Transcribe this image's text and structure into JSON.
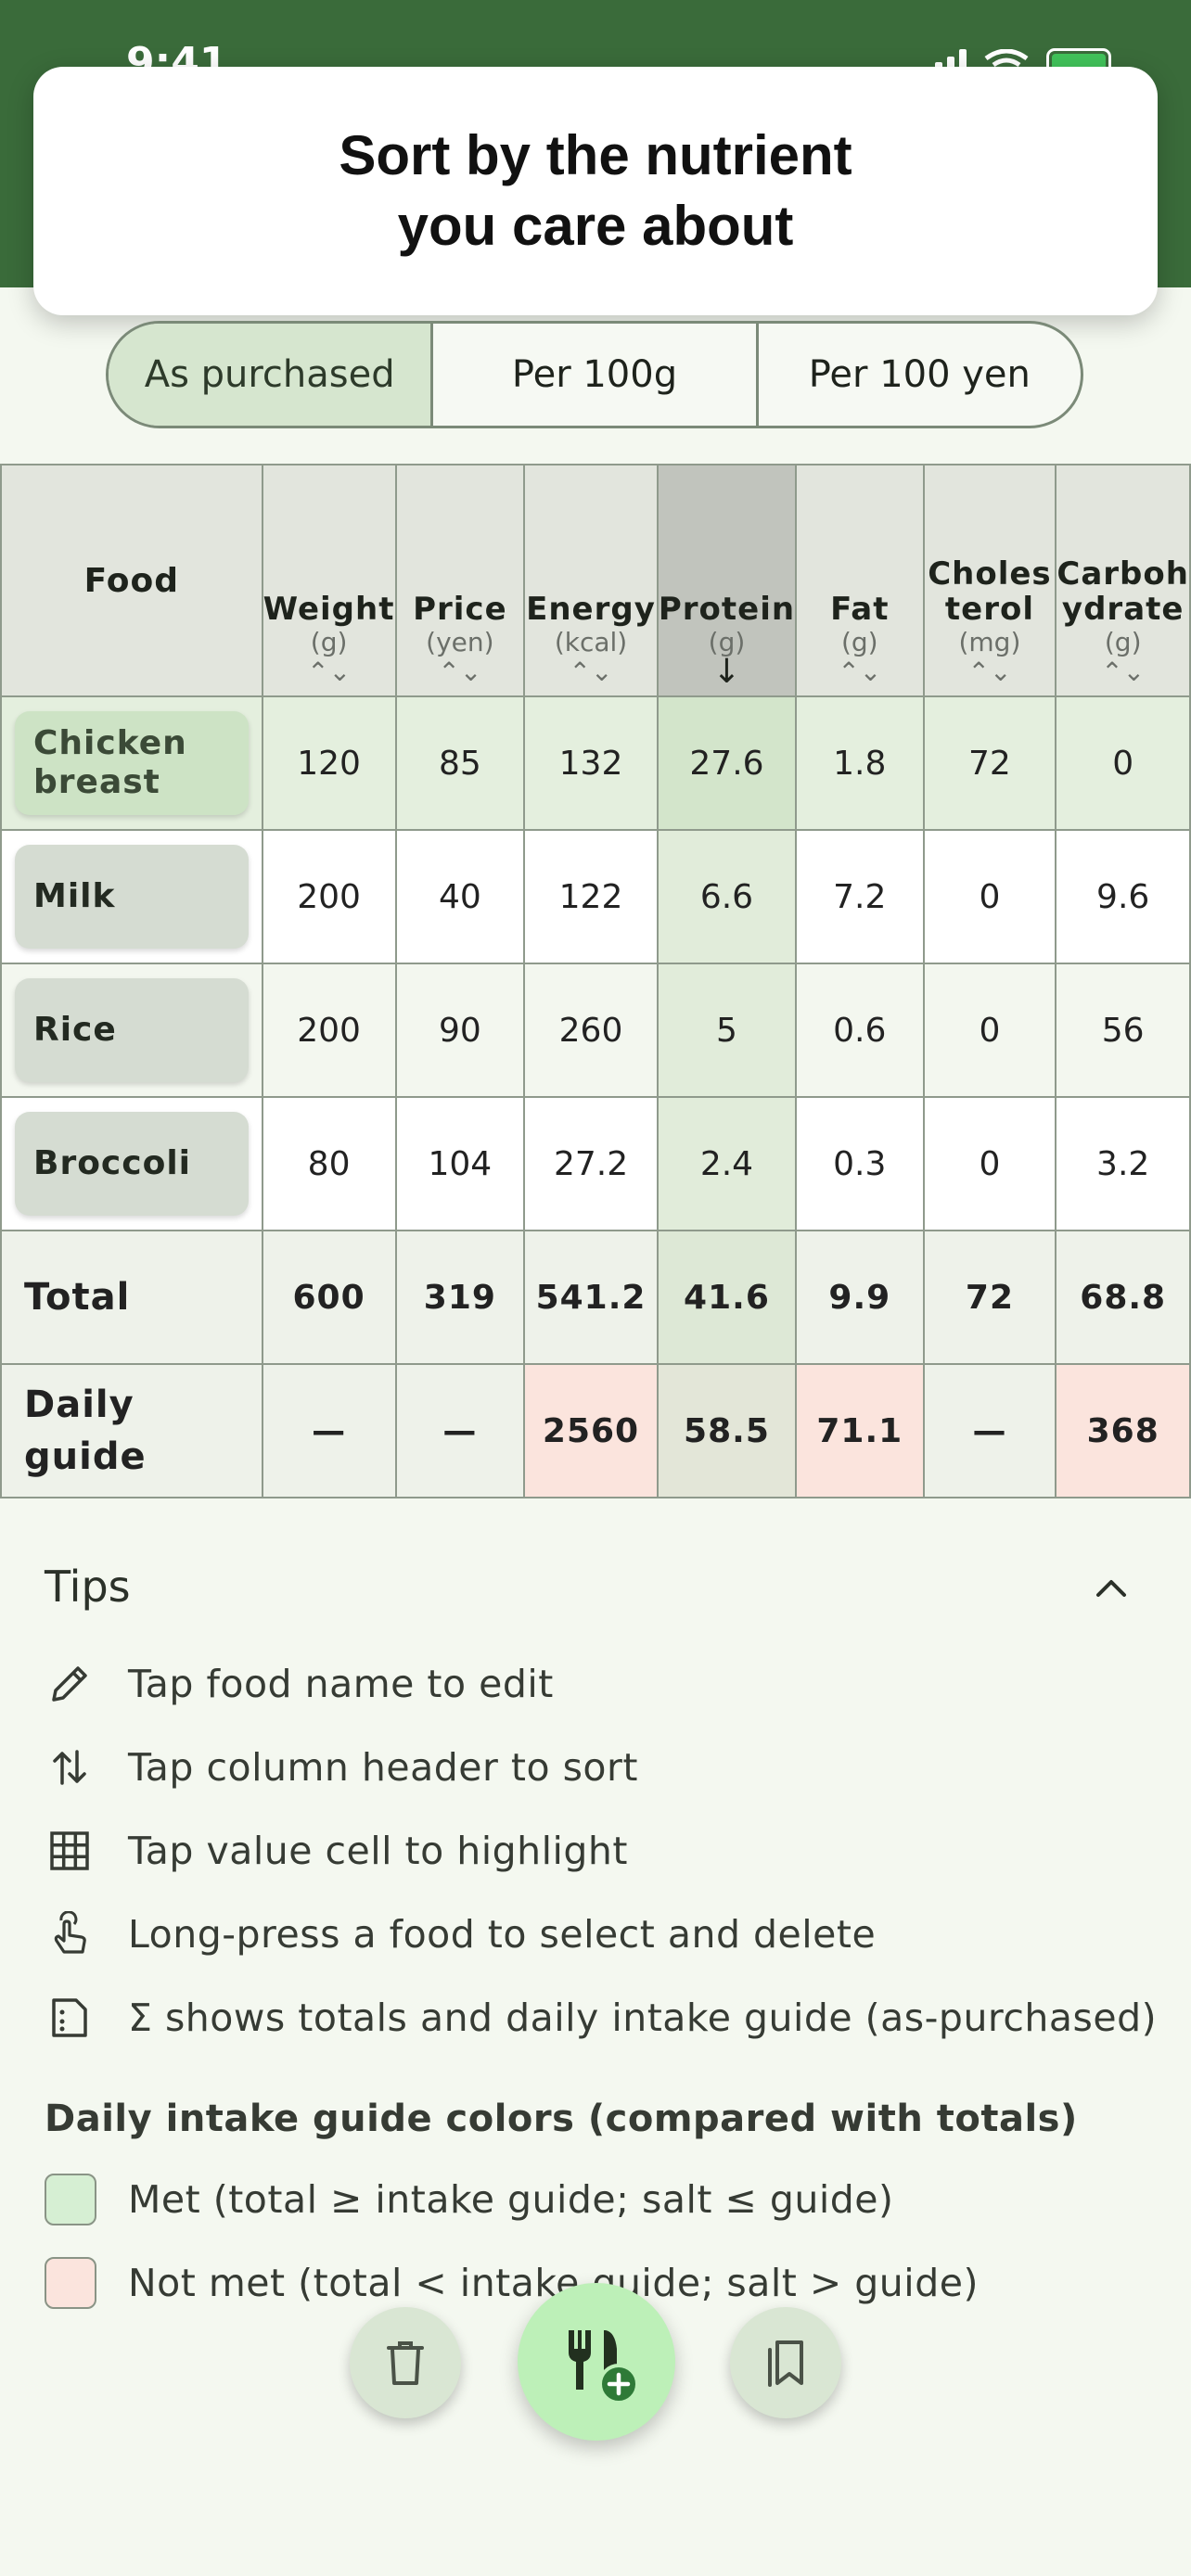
{
  "status": {
    "time": "9:41"
  },
  "banner": {
    "line1": "Sort by the nutrient",
    "line2": "you care about"
  },
  "segments": [
    "As purchased",
    "Per 100g",
    "Per 100 yen"
  ],
  "table": {
    "food_header": "Food",
    "columns": [
      {
        "name": "Weight",
        "unit": "(g)",
        "sort": "⌃⌄"
      },
      {
        "name": "Price",
        "unit": "(yen)",
        "sort": "⌃⌄"
      },
      {
        "name": "Energy",
        "unit": "(kcal)",
        "sort": "⌃⌄"
      },
      {
        "name": "Protein",
        "unit": "(g)",
        "sort": "↓"
      },
      {
        "name": "Fat",
        "unit": "(g)",
        "sort": "⌃⌄"
      },
      {
        "name1": "Choles",
        "name2": "terol",
        "unit": "(mg)",
        "sort": "⌃⌄"
      },
      {
        "name1": "Carboh",
        "name2": "ydrate",
        "unit": "(g)",
        "sort": "⌃⌄"
      }
    ],
    "rows": [
      {
        "food1": "Chicken",
        "food2": "breast",
        "values": [
          "120",
          "85",
          "132",
          "27.6",
          "1.8",
          "72",
          "0"
        ]
      },
      {
        "food": "Milk",
        "values": [
          "200",
          "40",
          "122",
          "6.6",
          "7.2",
          "0",
          "9.6"
        ]
      },
      {
        "food": "Rice",
        "values": [
          "200",
          "90",
          "260",
          "5",
          "0.6",
          "0",
          "56"
        ]
      },
      {
        "food": "Broccoli",
        "values": [
          "80",
          "104",
          "27.2",
          "2.4",
          "0.3",
          "0",
          "3.2"
        ]
      }
    ],
    "total": {
      "label": "Total",
      "values": [
        "600",
        "319",
        "541.2",
        "41.6",
        "9.9",
        "72",
        "68.8"
      ]
    },
    "guide": {
      "label1": "Daily",
      "label2": "guide",
      "values": [
        "—",
        "—",
        "2560",
        "58.5",
        "71.1",
        "—",
        "368"
      ]
    }
  },
  "tips": {
    "title": "Tips",
    "items": [
      {
        "icon": "pencil-icon",
        "text": "Tap food name to edit"
      },
      {
        "icon": "sort-arrows-icon",
        "text": "Tap column header to sort"
      },
      {
        "icon": "grid-icon",
        "text": "Tap value cell to highlight"
      },
      {
        "icon": "touch-hand-icon",
        "text": "Long-press a food to select and delete"
      },
      {
        "icon": "summary-document-icon",
        "text": "Σ shows totals and daily intake guide (as-purchased)"
      }
    ],
    "legend_title": "Daily intake guide colors (compared with totals)",
    "legend": [
      {
        "color": "#d6efd3",
        "text": "Met (total ≥ intake guide; salt ≤ guide)"
      },
      {
        "color": "#fbe4dd",
        "text": "Not met (total < intake guide; salt > guide)"
      }
    ]
  },
  "colors": {
    "header_green": "#3a6b3a",
    "segment_active": "#d6e6cf",
    "fab_primary": "#bdf0b8",
    "not_met": "#fbe4dd",
    "met": "#d6efd3"
  }
}
